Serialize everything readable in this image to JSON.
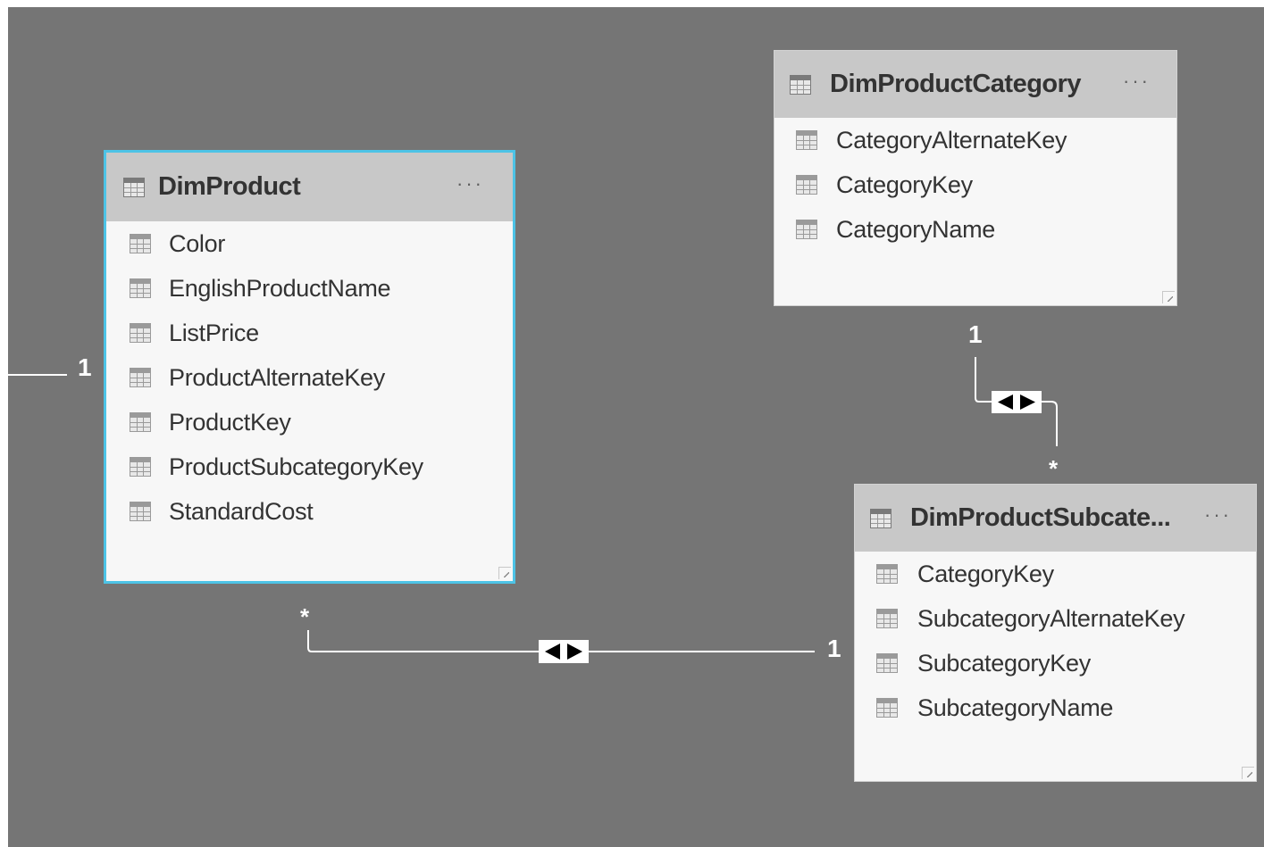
{
  "tables": {
    "dim_product": {
      "title": "DimProduct",
      "more": "···",
      "fields": [
        "Color",
        "EnglishProductName",
        "ListPrice",
        "ProductAlternateKey",
        "ProductKey",
        "ProductSubcategoryKey",
        "StandardCost"
      ]
    },
    "dim_product_category": {
      "title": "DimProductCategory",
      "more": "···",
      "fields": [
        "CategoryAlternateKey",
        "CategoryKey",
        "CategoryName"
      ]
    },
    "dim_product_subcategory": {
      "title": "DimProductSubcate...",
      "more": "···",
      "fields": [
        "CategoryKey",
        "SubcategoryAlternateKey",
        "SubcategoryKey",
        "SubcategoryName"
      ]
    }
  },
  "relationships": {
    "left_edge_end": "1",
    "product_end": "*",
    "subcategory_end": "1",
    "category_end": "1",
    "subcategory_top_end": "*"
  },
  "colors": {
    "canvas": "#757575",
    "selected_border": "#4dc3e6",
    "header": "#c8c8c8",
    "card": "#f7f7f7"
  }
}
